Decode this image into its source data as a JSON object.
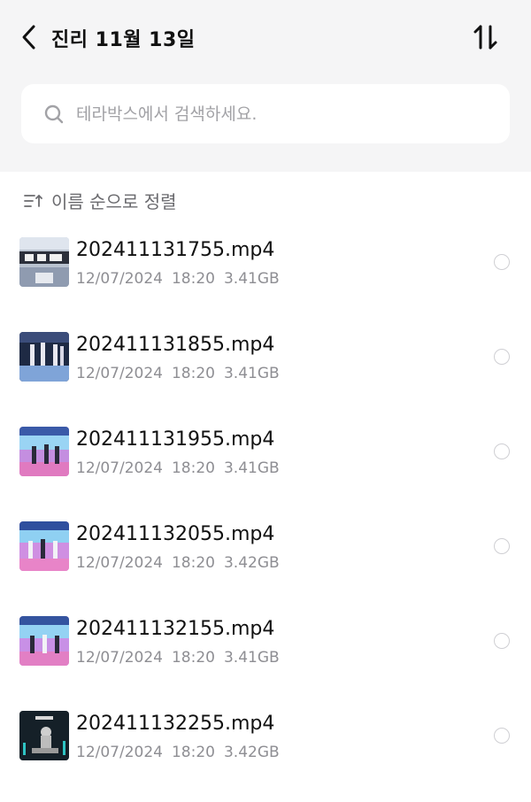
{
  "header": {
    "title": "진리 11월 13일",
    "back_icon": "chevron-left-icon",
    "sort_toggle_icon": "sort-arrows-icon"
  },
  "search": {
    "placeholder": "테라박스에서 검색하세요.",
    "value": "",
    "icon": "search-icon"
  },
  "sort": {
    "label": "이름 순으로 정렬",
    "icon": "sort-list-icon"
  },
  "files": [
    {
      "name": "202411131755.mp4",
      "date": "12/07/2024",
      "time": "18:20",
      "size": "3.41GB",
      "thumbnail": "stage-thumbnail-gray",
      "selected": false
    },
    {
      "name": "202411131855.mp4",
      "date": "12/07/2024",
      "time": "18:20",
      "size": "3.41GB",
      "thumbnail": "stage-thumbnail-dark-blue",
      "selected": false
    },
    {
      "name": "202411131955.mp4",
      "date": "12/07/2024",
      "time": "18:20",
      "size": "3.41GB",
      "thumbnail": "stage-thumbnail-pink",
      "selected": false
    },
    {
      "name": "202411132055.mp4",
      "date": "12/07/2024",
      "time": "18:20",
      "size": "3.42GB",
      "thumbnail": "stage-thumbnail-pink",
      "selected": false
    },
    {
      "name": "202411132155.mp4",
      "date": "12/07/2024",
      "time": "18:20",
      "size": "3.41GB",
      "thumbnail": "stage-thumbnail-pink",
      "selected": false
    },
    {
      "name": "202411132255.mp4",
      "date": "12/07/2024",
      "time": "18:20",
      "size": "3.42GB",
      "thumbnail": "dark-poster-thumbnail",
      "selected": false
    }
  ],
  "colors": {
    "header_bg": "#f5f5f6",
    "text_primary": "#111111",
    "text_secondary": "#8e8e93",
    "radio_border": "#cfcfd3"
  }
}
